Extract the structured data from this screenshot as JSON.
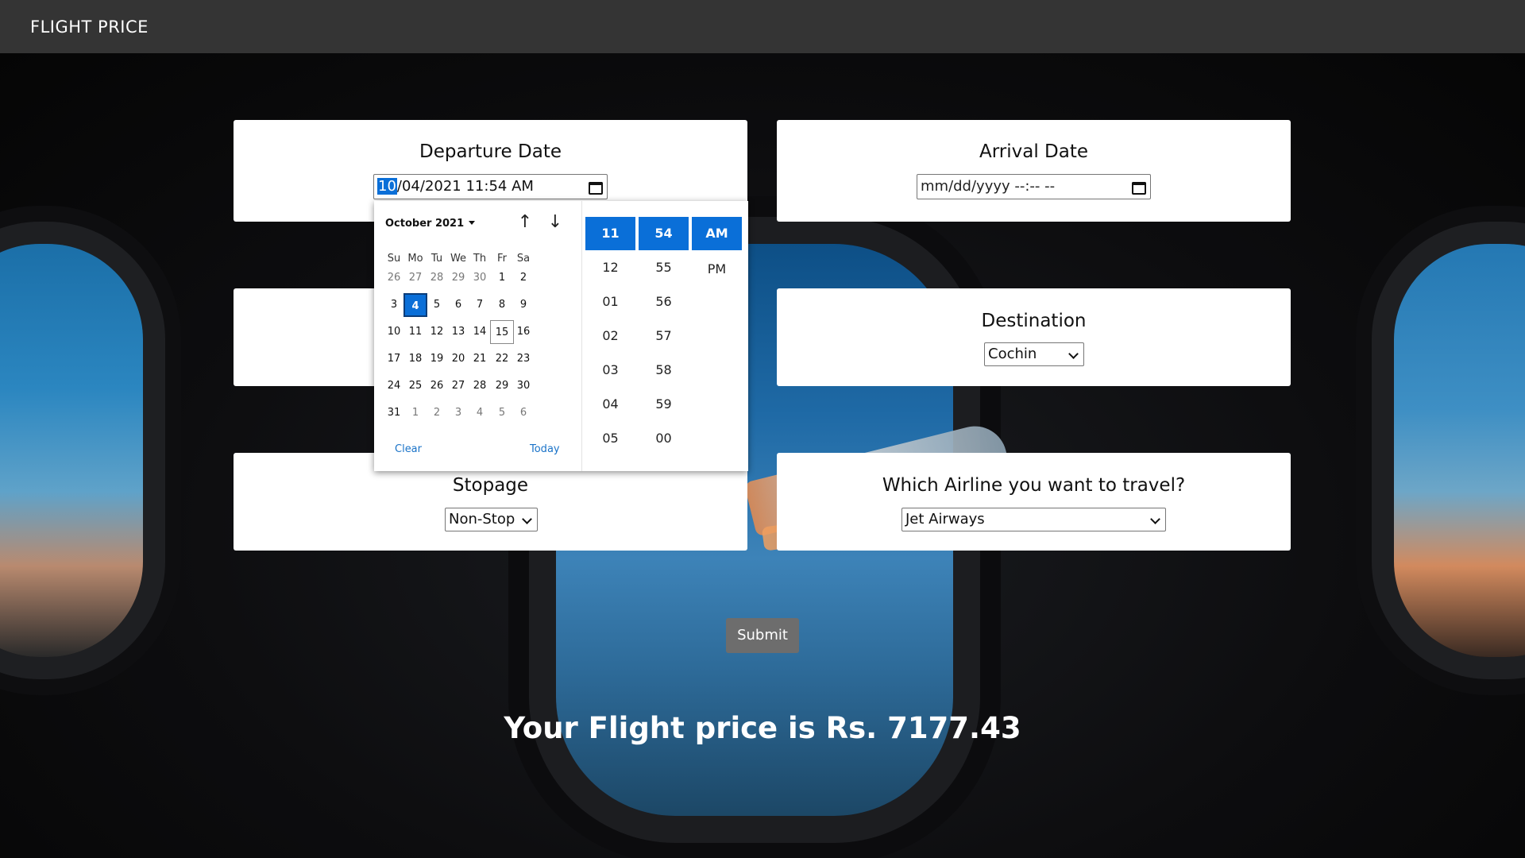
{
  "navbar": {
    "brand": "FLIGHT PRICE"
  },
  "departure": {
    "title": "Departure Date",
    "value_month": "10",
    "value_rest": "/04/2021 11:54 AM"
  },
  "arrival": {
    "title": "Arrival Date",
    "placeholder": "mm/dd/yyyy --:-- --"
  },
  "destination": {
    "title": "Destination",
    "selected": "Cochin"
  },
  "stopage": {
    "title": "Stopage",
    "selected": "Non-Stop"
  },
  "airline": {
    "title": "Which Airline you want to travel?",
    "selected": "Jet Airways"
  },
  "picker": {
    "month_label": "October 2021",
    "weekdays": [
      "Su",
      "Mo",
      "Tu",
      "We",
      "Th",
      "Fr",
      "Sa"
    ],
    "weeks": [
      [
        "26",
        "27",
        "28",
        "29",
        "30",
        "1",
        "2"
      ],
      [
        "3",
        "4",
        "5",
        "6",
        "7",
        "8",
        "9"
      ],
      [
        "10",
        "11",
        "12",
        "13",
        "14",
        "15",
        "16"
      ],
      [
        "17",
        "18",
        "19",
        "20",
        "21",
        "22",
        "23"
      ],
      [
        "24",
        "25",
        "26",
        "27",
        "28",
        "29",
        "30"
      ],
      [
        "31",
        "1",
        "2",
        "3",
        "4",
        "5",
        "6"
      ]
    ],
    "selected_day": "4",
    "today_day": "15",
    "clear_label": "Clear",
    "today_label": "Today",
    "hours": [
      "11",
      "12",
      "01",
      "02",
      "03",
      "04",
      "05"
    ],
    "minutes": [
      "54",
      "55",
      "56",
      "57",
      "58",
      "59",
      "00"
    ],
    "ampm": [
      "AM",
      "PM"
    ]
  },
  "submit_label": "Submit",
  "result_text": "Your Flight price is Rs. 7177.43",
  "colors": {
    "navbar": "#343434",
    "accent": "#0a6fd8",
    "submit": "#6d6d6d"
  }
}
